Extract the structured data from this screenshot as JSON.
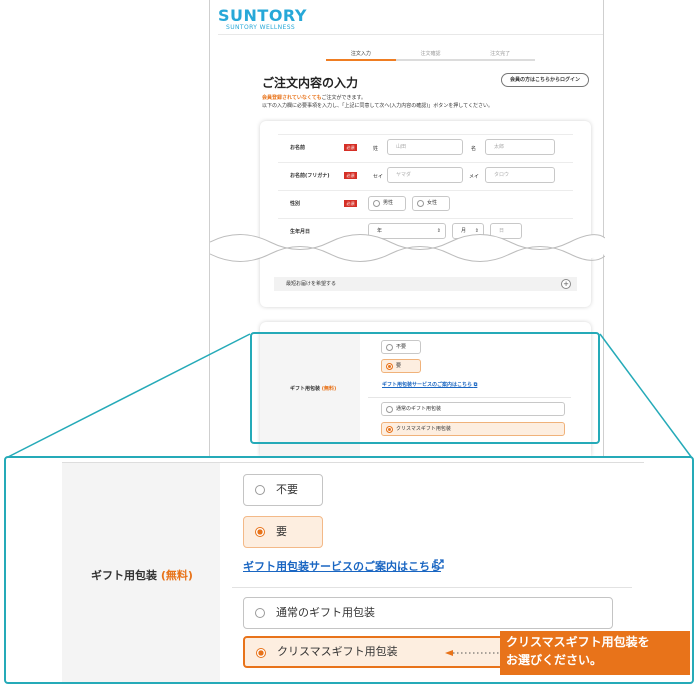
{
  "brand": {
    "logo": "SUNTORY",
    "sub": "SUNTORY WELLNESS",
    "color": "#27a8d8"
  },
  "steps": [
    "注文入力",
    "注文確認",
    "注文完了"
  ],
  "page": {
    "title": "ご注文内容の入力",
    "login_button": "会員の方はこちらからログイン",
    "note_orange": "会員登録されていなくても",
    "note_rest": "ご注文ができます。",
    "note2": "以下の入力欄に必要事項を入力し、「上記に同意して次へ(入力内容の確認)」ボタンを押してください。"
  },
  "form": {
    "required": "必須",
    "name": {
      "label": "お名前",
      "sei": "姓",
      "mei": "名",
      "sei_ph": "山田",
      "mei_ph": "太郎"
    },
    "kana": {
      "label": "お名前(フリガナ)",
      "sei": "セイ",
      "mei": "メイ",
      "sei_ph": "ヤマダ",
      "mei_ph": "タロウ"
    },
    "gender": {
      "label": "性別",
      "male": "男性",
      "female": "女性"
    },
    "birthday": {
      "label": "生年月日",
      "year": "年",
      "month": "月",
      "day": "日"
    },
    "fastest": "最短お届けを希望する"
  },
  "gift": {
    "label": "ギフト用包装",
    "free": "(無料)",
    "opt_no": "不要",
    "opt_yes": "要",
    "link": "ギフト用包装サービスのご案内はこちら",
    "wrap_normal": "通常のギフト用包装",
    "wrap_xmas": "クリスマスギフト用包装"
  },
  "callout": {
    "line1": "クリスマスギフト用包装を",
    "line2": "お選びください。"
  },
  "colors": {
    "accent": "#e8731a",
    "highlight": "#25aab8",
    "link": "#1a66c2",
    "required": "#d52f26"
  }
}
